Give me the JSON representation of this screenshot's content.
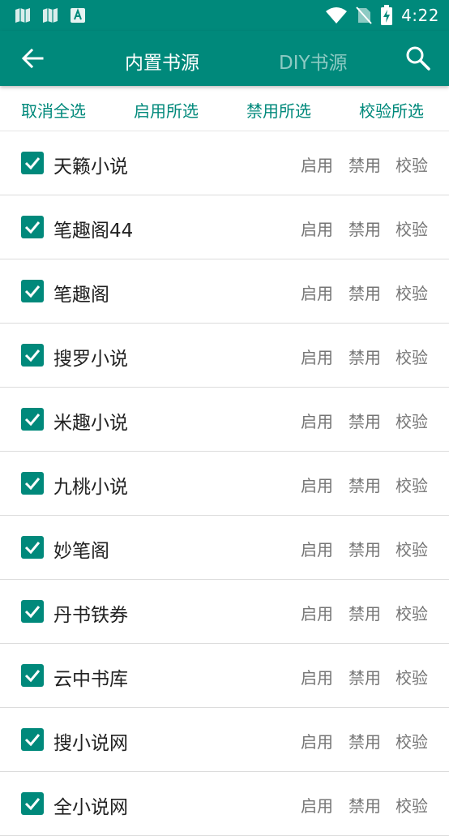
{
  "status_bar": {
    "time": "4:22",
    "left_icons": [
      "map-icon",
      "map-icon",
      "font-icon"
    ],
    "right_icons": [
      "wifi-icon",
      "no-sim-icon",
      "battery-charging-icon"
    ]
  },
  "toolbar": {
    "tabs": [
      {
        "label": "内置书源",
        "active": true
      },
      {
        "label": "DIY书源",
        "active": false
      }
    ]
  },
  "actions": {
    "deselect_all": "取消全选",
    "enable_selected": "启用所选",
    "disable_selected": "禁用所选",
    "verify_selected": "校验所选"
  },
  "row_ops": {
    "enable": "启用",
    "disable": "禁用",
    "verify": "校验"
  },
  "sources": [
    {
      "name": "天籁小说",
      "checked": true
    },
    {
      "name": "笔趣阁44",
      "checked": true
    },
    {
      "name": "笔趣阁",
      "checked": true
    },
    {
      "name": "搜罗小说",
      "checked": true
    },
    {
      "name": "米趣小说",
      "checked": true
    },
    {
      "name": "九桃小说",
      "checked": true
    },
    {
      "name": "妙笔阁",
      "checked": true
    },
    {
      "name": "丹书铁券",
      "checked": true
    },
    {
      "name": "云中书库",
      "checked": true
    },
    {
      "name": "搜小说网",
      "checked": true
    },
    {
      "name": "全小说网",
      "checked": true
    }
  ],
  "colors": {
    "primary": "#00897b",
    "text": "#212121",
    "secondary_text": "#757575"
  }
}
